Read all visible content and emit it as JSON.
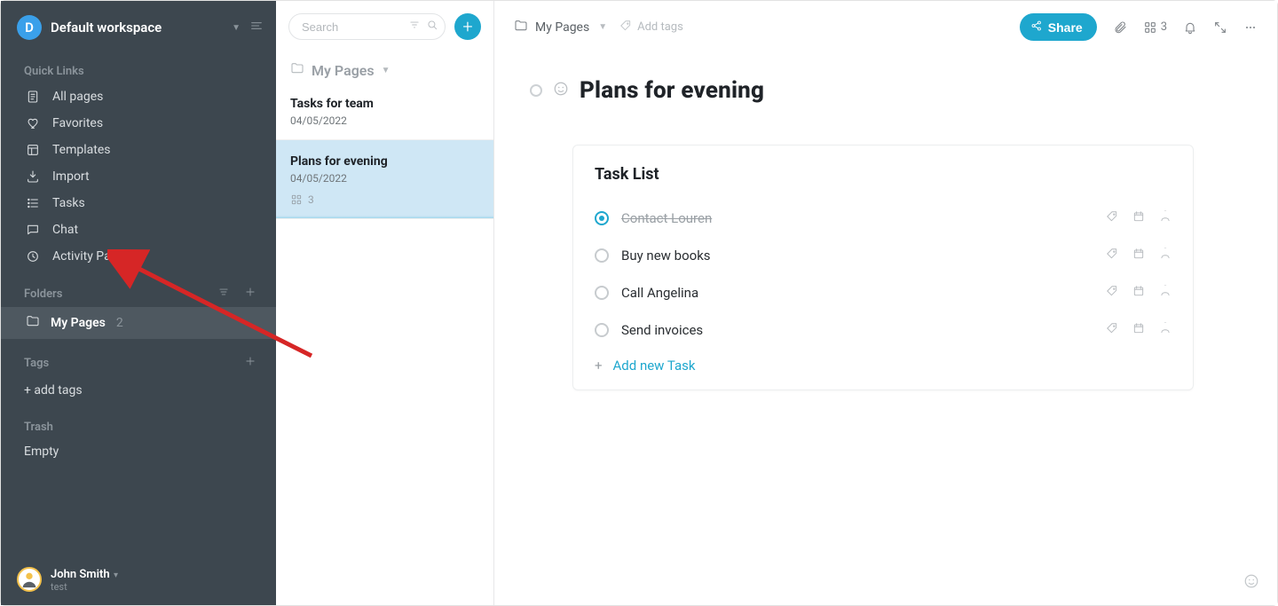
{
  "workspace": {
    "avatar_letter": "D",
    "name": "Default workspace"
  },
  "sidebar": {
    "quick_links_label": "Quick Links",
    "items": [
      {
        "label": "All pages"
      },
      {
        "label": "Favorites"
      },
      {
        "label": "Templates"
      },
      {
        "label": "Import"
      },
      {
        "label": "Tasks"
      },
      {
        "label": "Chat"
      },
      {
        "label": "Activity Panel"
      }
    ],
    "folders_label": "Folders",
    "folder": {
      "name": "My Pages",
      "count": "2"
    },
    "tags_label": "Tags",
    "add_tags_label": "+ add tags",
    "trash_label": "Trash",
    "trash_empty": "Empty"
  },
  "user": {
    "name": "John Smith",
    "sub": "test"
  },
  "mid": {
    "search_placeholder": "Search",
    "crumb": "My Pages",
    "notes": [
      {
        "title": "Tasks for team",
        "date": "04/05/2022",
        "selected": false
      },
      {
        "title": "Plans for evening",
        "date": "04/05/2022",
        "selected": true,
        "relation_count": "3"
      }
    ]
  },
  "main": {
    "crumb": "My Pages",
    "add_tags": "Add tags",
    "share": "Share",
    "relation_badge": "3",
    "title": "Plans for evening",
    "card_title": "Task List",
    "tasks": [
      {
        "label": "Contact Louren",
        "done": true
      },
      {
        "label": "Buy new books",
        "done": false
      },
      {
        "label": "Call Angelina",
        "done": false
      },
      {
        "label": "Send invoices",
        "done": false
      }
    ],
    "add_task": "Add new Task"
  }
}
